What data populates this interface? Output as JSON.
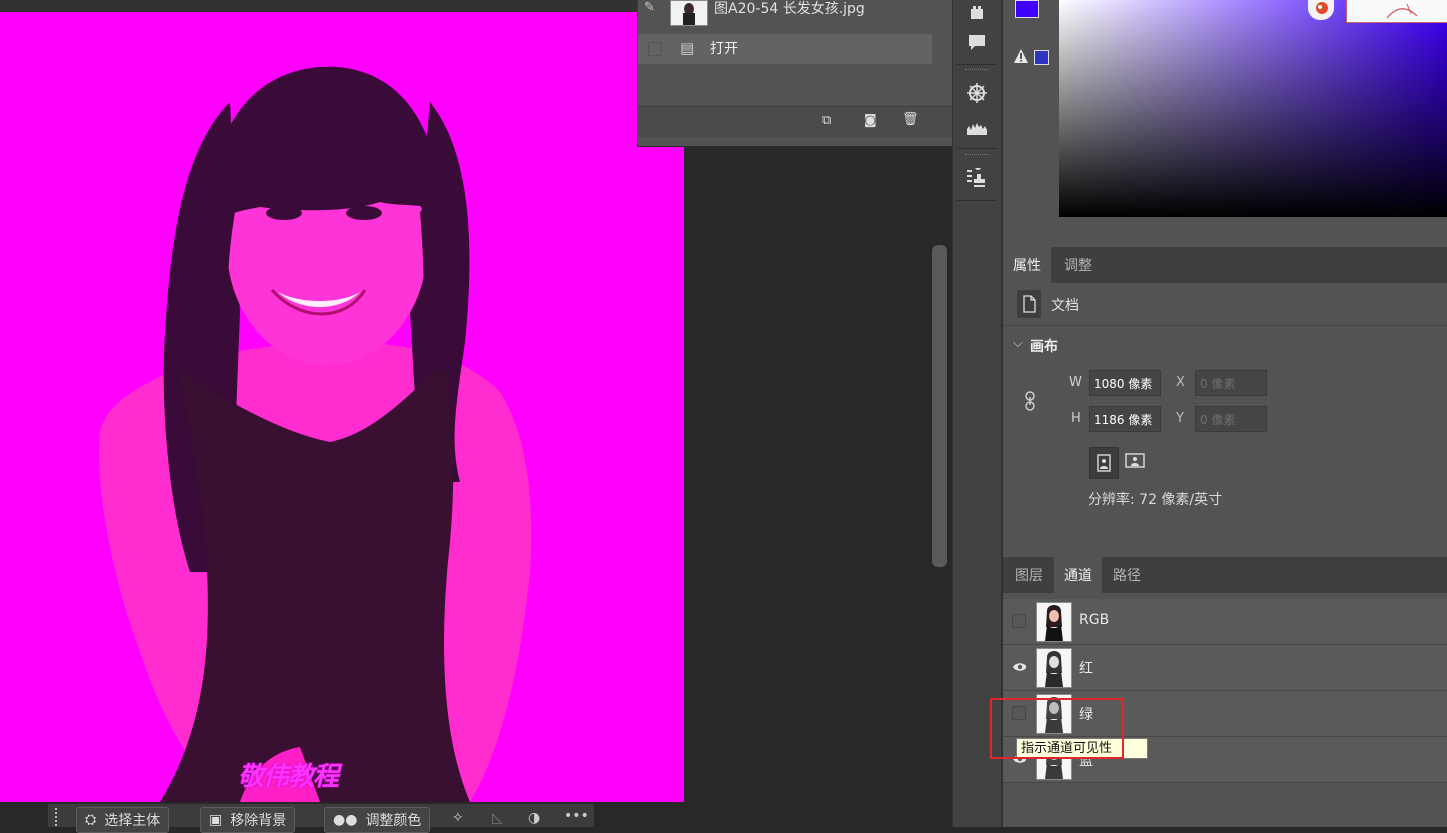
{
  "canvas": {
    "watermark": "敬伟教程"
  },
  "taskbar": {
    "select_subject": "选择主体",
    "remove_background": "移除背景",
    "adjust_color": "调整颜色",
    "more": "•••"
  },
  "history": {
    "snapshot_label": "图A20-54 长发女孩.jpg",
    "open_label": "打开"
  },
  "properties": {
    "tabs": [
      "属性",
      "调整"
    ],
    "doc_label": "文档",
    "canvas_section": "画布",
    "w_label": "W",
    "w_value": "1080 像素",
    "h_label": "H",
    "h_value": "1186 像素",
    "x_label": "X",
    "x_placeholder": "0 像素",
    "y_label": "Y",
    "y_placeholder": "0 像素",
    "resolution": "分辨率: 72 像素/英寸"
  },
  "channels_panel": {
    "tabs": [
      "图层",
      "通道",
      "路径"
    ],
    "channels": [
      {
        "name": "RGB",
        "visible": false
      },
      {
        "name": "红",
        "visible": true
      },
      {
        "name": "绿",
        "visible": false
      },
      {
        "name": "蓝",
        "visible": true
      }
    ],
    "tooltip": "指示通道可见性"
  },
  "colors": {
    "foreground": "#3f00ff",
    "background": "#ffffff",
    "canvas_tint": "#ff00ff",
    "highlight": "#e0262d"
  }
}
